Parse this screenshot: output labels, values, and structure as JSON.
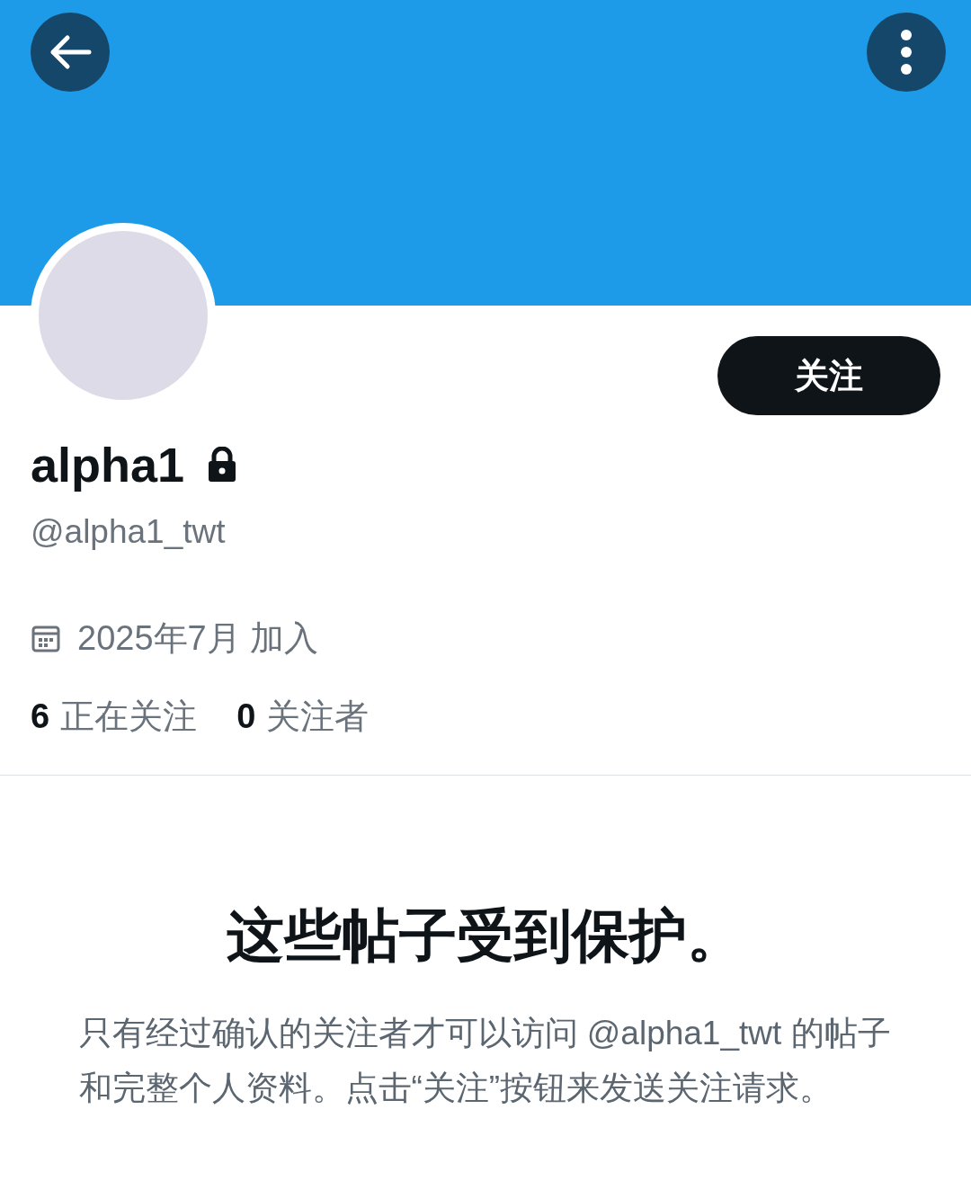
{
  "profile": {
    "name": "alpha1",
    "protected": true,
    "handle": "@alpha1_twt",
    "joined": "2025年7月 加入",
    "follow_button": "关注"
  },
  "stats": [
    {
      "count": "6",
      "label": "正在关注"
    },
    {
      "count": "0",
      "label": "关注者"
    }
  ],
  "protected_notice": {
    "title": "这些帖子受到保护。",
    "body": "只有经过确认的关注者才可以访问 @alpha1_twt 的帖子和完整个人资料。点击“关注”按钮来发送关注请求。"
  }
}
